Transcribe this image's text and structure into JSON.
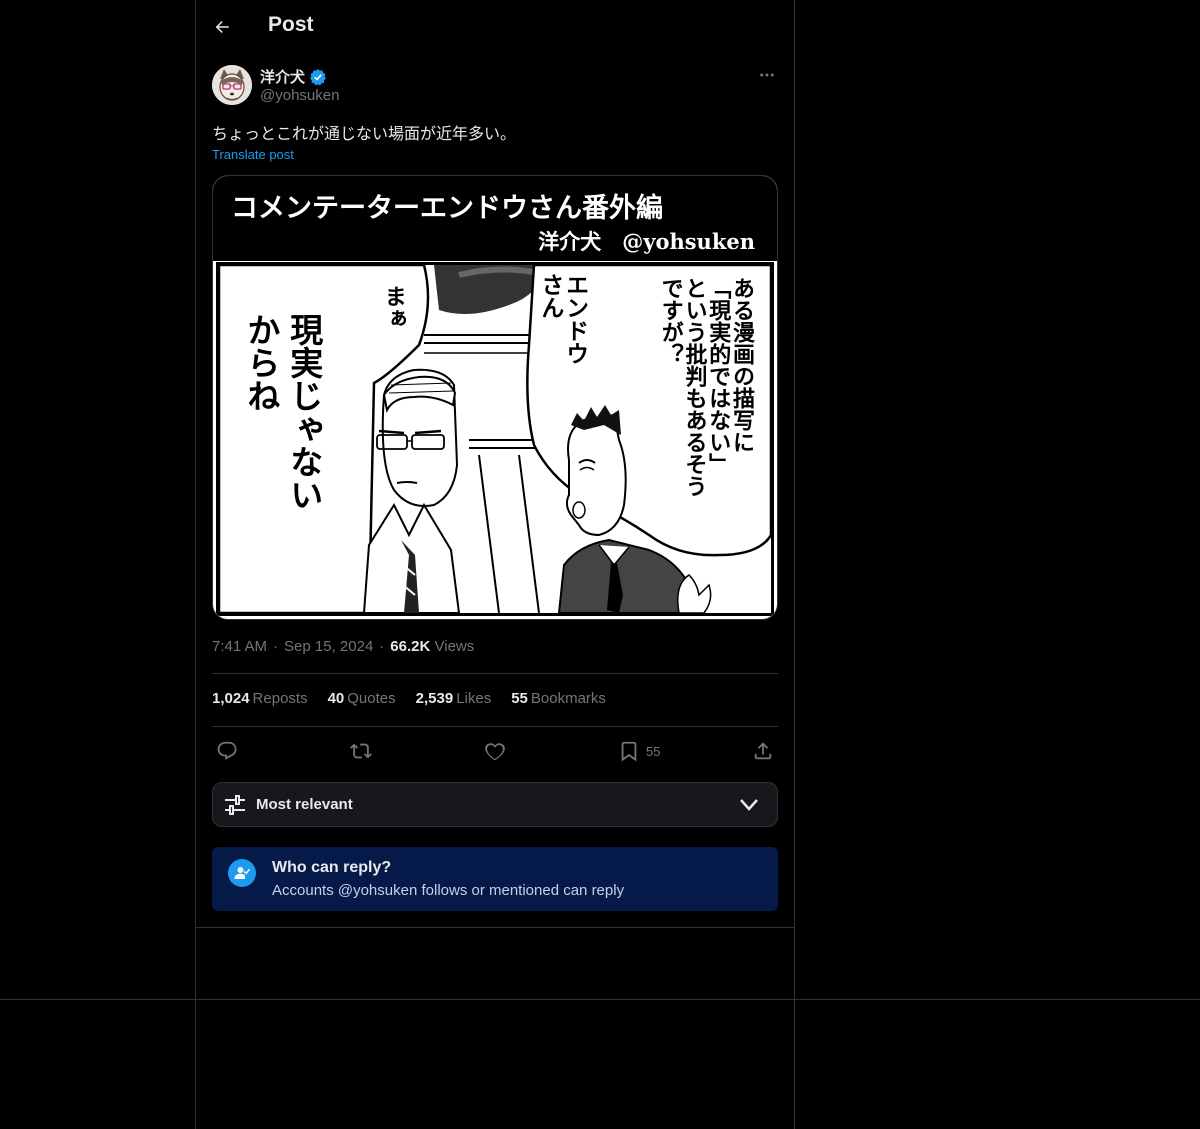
{
  "header": {
    "title": "Post"
  },
  "author": {
    "name": "洋介犬",
    "handle": "@yohsuken",
    "verified": true
  },
  "post": {
    "text": "ちょっとこれが通じない場面が近年多い。",
    "translate_label": "Translate post"
  },
  "media": {
    "title": "コメンテーターエンドウさん番外編",
    "credit": "洋介犬　@yohsuken",
    "bubble_right": [
      "ある漫画の描写に",
      "「現実的ではない」",
      "という批判もあるそう",
      "ですが？"
    ],
    "bubble_name": [
      "エンドウ",
      "さん"
    ],
    "bubble_left_small": "まぁ",
    "bubble_left": [
      "現実じゃない",
      "からね"
    ]
  },
  "meta": {
    "time": "7:41 AM",
    "date": "Sep 15, 2024",
    "views_count": "66.2K",
    "views_label": "Views"
  },
  "stats": {
    "reposts_count": "1,024",
    "reposts_label": "Reposts",
    "quotes_count": "40",
    "quotes_label": "Quotes",
    "likes_count": "2,539",
    "likes_label": "Likes",
    "bookmarks_count": "55",
    "bookmarks_label": "Bookmarks"
  },
  "actions": {
    "bookmark_count": "55"
  },
  "sort": {
    "label": "Most relevant"
  },
  "reply_restriction": {
    "title": "Who can reply?",
    "subtitle": "Accounts @yohsuken follows or mentioned can reply"
  },
  "colors": {
    "accent": "#1d9bf0",
    "background": "#000000",
    "border": "#2f3336",
    "muted": "#71767b",
    "reply_box": "#061a4a"
  },
  "icons": [
    "back-arrow-icon",
    "verified-badge-icon",
    "more-icon",
    "reply-icon",
    "repost-icon",
    "like-icon",
    "bookmark-icon",
    "share-icon",
    "sliders-icon",
    "chevron-down-icon",
    "person-check-icon"
  ]
}
